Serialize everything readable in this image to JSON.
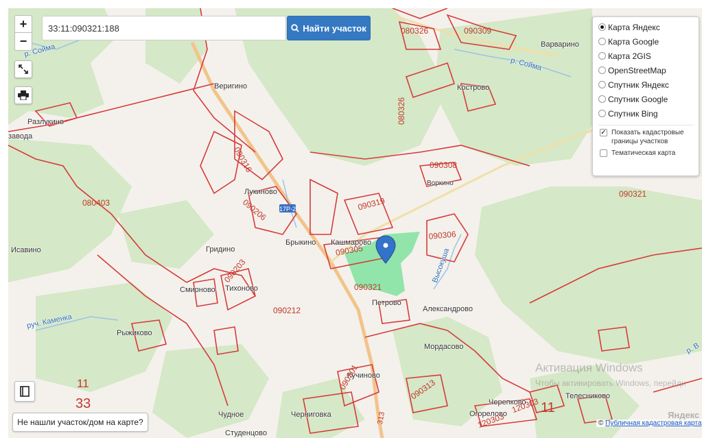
{
  "search": {
    "value": "33:11:090321:188",
    "button_label": "Найти участок"
  },
  "zoom": {
    "in_label": "+",
    "out_label": "−"
  },
  "layers": {
    "base_options": [
      {
        "label": "Карта Яндекс",
        "selected": true
      },
      {
        "label": "Карта Google",
        "selected": false
      },
      {
        "label": "Карта 2GIS",
        "selected": false
      },
      {
        "label": "OpenStreetMap",
        "selected": false
      },
      {
        "label": "Спутник Яндекс",
        "selected": false
      },
      {
        "label": "Спутник Google",
        "selected": false
      },
      {
        "label": "Спутник Bing",
        "selected": false
      }
    ],
    "overlays": [
      {
        "label": "Показать кадастровые границы участков",
        "checked": true
      },
      {
        "label": "Тематическая карта",
        "checked": false
      }
    ]
  },
  "not_found_label": "Не нашли участок/дом на карте?",
  "attribution": {
    "prefix": "©",
    "link": "Публичная кадастровая карта"
  },
  "watermark": {
    "title": "Активация Windows",
    "subtitle": "Чтобы активировать Windows, перейди"
  },
  "yandex_logo": "Яндекс",
  "map_labels": {
    "veriginoo": "Веригино",
    "razlukino": "Разлукино",
    "kostrovo": "Кострово",
    "varvarino": "Варварино",
    "lukinovo": "Лукиново",
    "brykino": "Брыкино",
    "kashmarovo": "Кашмарово",
    "gridino": "Гридино",
    "smirnovo": "Смирново",
    "tikhonovo": "Тихоново",
    "petrovo": "Петрово",
    "aleksandrovo": "Александрово",
    "mordasovo": "Мордасово",
    "ryzhikovo": "Рыжиково",
    "chudnoe": "Чудное",
    "chernigovka": "Черниговка",
    "studencovo": "Студенцово",
    "isavino": "Исавино",
    "kuchinovo": "Кучиново",
    "cherepovo": "Черепково",
    "telesnikovo": "Телесниково",
    "ogorevo": "Огорелово",
    "vorkino": "Воркино",
    "zavoda": "завода",
    "r_soima_top": "р. Сойма",
    "r_soima_right": "р. Сойма",
    "ruch_kamenka": "руч. Каменка",
    "vysokusha": "Высокуша",
    "r_v": "р. В",
    "road_num": "17Р-2",
    "c080326_top": "080326",
    "c080326_side": "080326",
    "c090309": "090309",
    "c090316": "090316",
    "c090206": "090206",
    "c090319": "090319",
    "c090305": "090305",
    "c090306": "090306",
    "c090321_center": "090321",
    "c090321_right": "090321",
    "c090203": "090203",
    "c090212": "090212",
    "c080403": "080403",
    "c090301": "090301",
    "c090313": "090313",
    "c120303": "120303",
    "c120303b": "120303",
    "c11": "11",
    "c33": "33",
    "c11b": "11",
    "c313": "313",
    "c090308": "090308"
  }
}
